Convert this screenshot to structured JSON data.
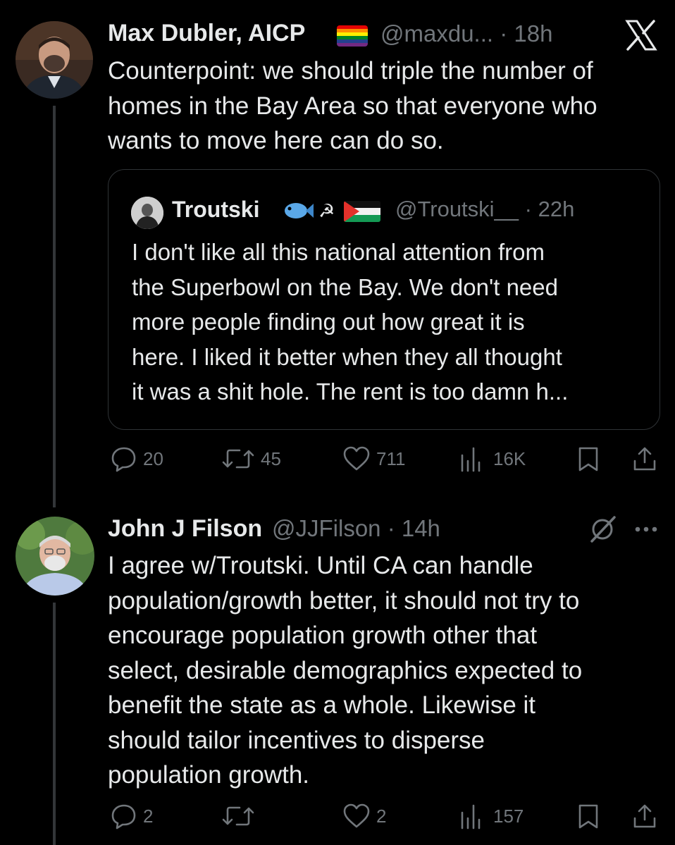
{
  "tweets": [
    {
      "author": "Max Dubler, AICP",
      "handle_time": "@maxdu... · 18h",
      "text_lines": [
        "Counterpoint: we should triple the number of",
        "homes in the Bay Area so that everyone who",
        "wants to move here can do so."
      ],
      "quote": {
        "author": "Troutski",
        "handle_time": "@Troutski__ · 22h",
        "text_lines": [
          "I don't like all this national attention from",
          "the Superbowl on the Bay. We don't need",
          "more people finding out how great it is",
          "here. I liked it better when they all thought",
          "it was a shit hole. The rent is too damn h..."
        ]
      },
      "actions": {
        "replies": "20",
        "retweets": "45",
        "likes": "711",
        "views": "16K"
      }
    },
    {
      "author": "John J Filson",
      "handle_time": "@JJFilson · 14h",
      "text_lines": [
        "I agree w/Troutski. Until CA can handle",
        "population/growth better, it should not try to",
        "encourage population growth other that",
        "select, desirable demographics expected to",
        "benefit the state as a whole. Likewise it",
        "should tailor incentives to disperse",
        "population growth."
      ],
      "actions": {
        "replies": "2",
        "retweets": "",
        "likes": "2",
        "views": "157"
      }
    }
  ],
  "icons": {
    "x_logo": "x-logo-icon",
    "reply": "reply-icon",
    "retweet": "retweet-icon",
    "like": "heart-icon",
    "views": "views-icon",
    "bookmark": "bookmark-icon",
    "share": "share-icon",
    "more": "more-icon",
    "grok": "grok-icon"
  },
  "colors": {
    "background": "#000000",
    "text": "#e7e9ea",
    "secondary": "#71767b",
    "border": "#2f3336"
  }
}
